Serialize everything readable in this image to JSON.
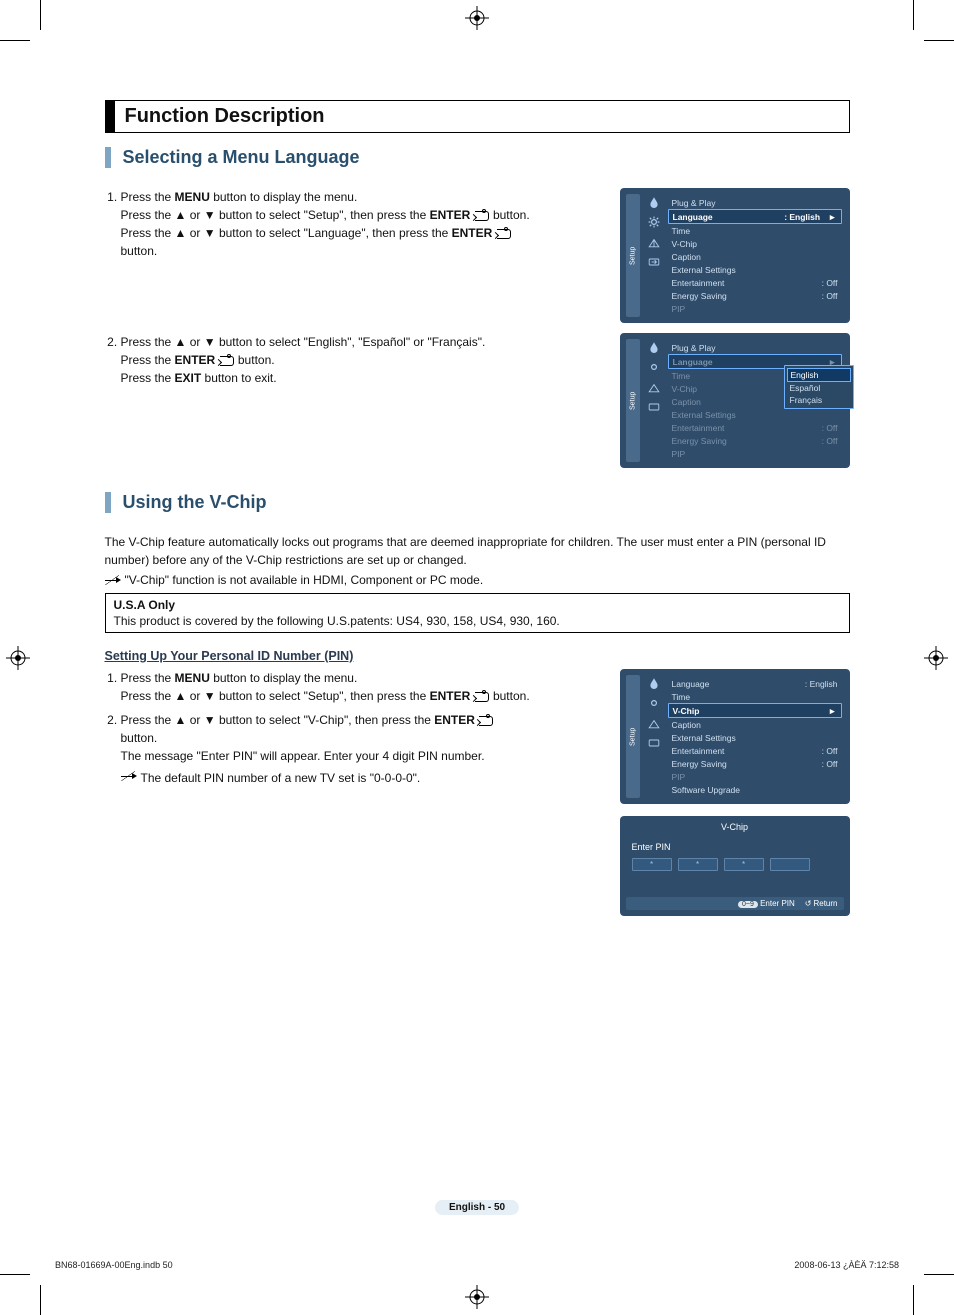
{
  "title_bar": "Function Description",
  "section1": {
    "title": "Selecting a Menu Language",
    "step1_a": "Press the ",
    "step1_menu": "MENU",
    "step1_b": " button to display the menu.",
    "step1_c": "Press the ▲ or ▼ button to select \"Setup\", then press the ",
    "step1_enter": "ENTER",
    "step1_d": " button.",
    "step1_e": "Press the ▲ or ▼ button to select \"Language\", then press the ",
    "step1_f": " button.",
    "step2_a": "Press the ▲ or ▼ button to select \"English\", \"Español\" or \"Français\".",
    "step2_b": "Press the ",
    "step2_c": " button.",
    "step2_d": "Press the ",
    "step2_exit": "EXIT",
    "step2_e": " button to exit."
  },
  "osd1": {
    "tab": "Setup",
    "items": [
      {
        "label": "Plug & Play",
        "value": ""
      },
      {
        "label": "Language",
        "value": ": English",
        "hl": true
      },
      {
        "label": "Time",
        "value": ""
      },
      {
        "label": "V-Chip",
        "value": ""
      },
      {
        "label": "Caption",
        "value": ""
      },
      {
        "label": "External Settings",
        "value": ""
      },
      {
        "label": "Entertainment",
        "value": ": Off"
      },
      {
        "label": "Energy Saving",
        "value": ": Off"
      },
      {
        "label": "PIP",
        "value": "",
        "dim": true
      }
    ]
  },
  "osd2": {
    "tab": "Setup",
    "options": [
      "English",
      "Español",
      "Français"
    ],
    "items": [
      {
        "label": "Plug & Play",
        "value": ""
      },
      {
        "label": "Language",
        "value": "",
        "hl": true,
        "dim": true
      },
      {
        "label": "Time",
        "value": "",
        "dim": true
      },
      {
        "label": "V-Chip",
        "value": "",
        "dim": true
      },
      {
        "label": "Caption",
        "value": "",
        "dim": true
      },
      {
        "label": "External Settings",
        "value": "",
        "dim": true
      },
      {
        "label": "Entertainment",
        "value": ": Off",
        "dim": true
      },
      {
        "label": "Energy Saving",
        "value": ": Off",
        "dim": true
      },
      {
        "label": "PIP",
        "value": "",
        "dim": true
      }
    ]
  },
  "section2": {
    "title": "Using the V-Chip",
    "intro": "The V-Chip feature automatically locks out programs that are deemed inappropriate for children. The user must enter a PIN (personal ID number) before any of the V-Chip restrictions are set up or changed.",
    "note": "\"V-Chip\" function is not available in HDMI, Component or PC mode.",
    "box_title": "U.S.A Only",
    "box_text": "This product is covered by the following U.S.patents: US4, 930, 158, US4, 930, 160.",
    "sub_h": "Setting Up Your Personal ID Number (PIN)",
    "s1_a": "Press the ",
    "s1_menu": "MENU",
    "s1_b": " button to display the menu.",
    "s1_c": "Press the ▲ or ▼ button to select \"Setup\", then press the ",
    "s1_enter": "ENTER",
    "s1_d": " button.",
    "s2_a": "Press the ▲ or ▼ button to select \"V-Chip\", then press the ",
    "s2_b": " button.",
    "s2_c": "The message \"Enter PIN\" will appear. Enter your 4 digit PIN number.",
    "s2_note": "The default PIN number of a new TV set is \"0-0-0-0\"."
  },
  "osd3": {
    "tab": "Setup",
    "items": [
      {
        "label": "Language",
        "value": ": English"
      },
      {
        "label": "Time",
        "value": ""
      },
      {
        "label": "V-Chip",
        "value": "",
        "hl": true
      },
      {
        "label": "Caption",
        "value": ""
      },
      {
        "label": "External Settings",
        "value": ""
      },
      {
        "label": "Entertainment",
        "value": ": Off"
      },
      {
        "label": "Energy Saving",
        "value": ": Off"
      },
      {
        "label": "PIP",
        "value": "",
        "dim": true
      },
      {
        "label": "Software Upgrade",
        "value": ""
      }
    ]
  },
  "pin_osd": {
    "title": "V-Chip",
    "label": "Enter PIN",
    "stars": [
      "*",
      "*",
      "*",
      ""
    ],
    "foot_pill": "0~9",
    "foot_enter": "Enter PIN",
    "foot_return": "Return"
  },
  "page_foot": "English - 50",
  "file_left": "BN68-01669A-00Eng.indb   50",
  "file_right": "2008-06-13   ¿ÀÈÄ 7:12:58"
}
